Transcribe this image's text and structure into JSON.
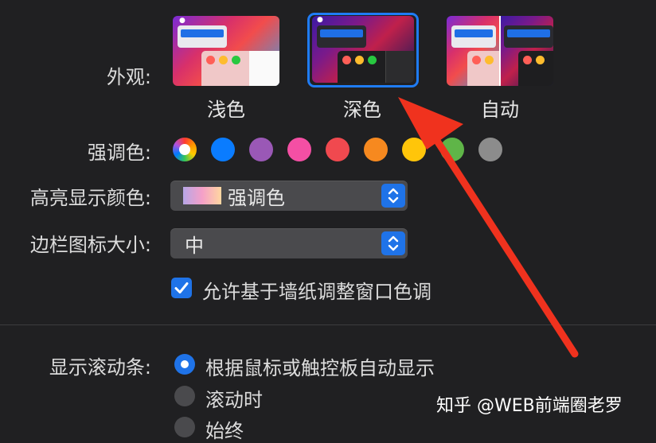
{
  "appearance": {
    "label": "外观:",
    "options": [
      "浅色",
      "深色",
      "自动"
    ],
    "selected": "深色"
  },
  "accent": {
    "label": "强调色:",
    "colors": [
      "multicolor",
      "#0a7cff",
      "#9a58b6",
      "#f44fa4",
      "#f0494f",
      "#f6891f",
      "#ffc50a",
      "#5fb548",
      "#8c8c8c"
    ]
  },
  "highlight": {
    "label": "高亮显示颜色:",
    "value": "强调色"
  },
  "sidebar_icon_size": {
    "label": "边栏图标大小:",
    "value": "中"
  },
  "wallpaper_tint": {
    "label": "允许基于墙纸调整窗口色调",
    "checked": true
  },
  "scrollbars": {
    "label": "显示滚动条:",
    "options": [
      "根据鼠标或触控板自动显示",
      "滚动时",
      "始终"
    ],
    "selected": "根据鼠标或触控板自动显示"
  },
  "watermark": "知乎 @WEB前端圈老罗",
  "annotation_arrow_color": "#f0321e"
}
